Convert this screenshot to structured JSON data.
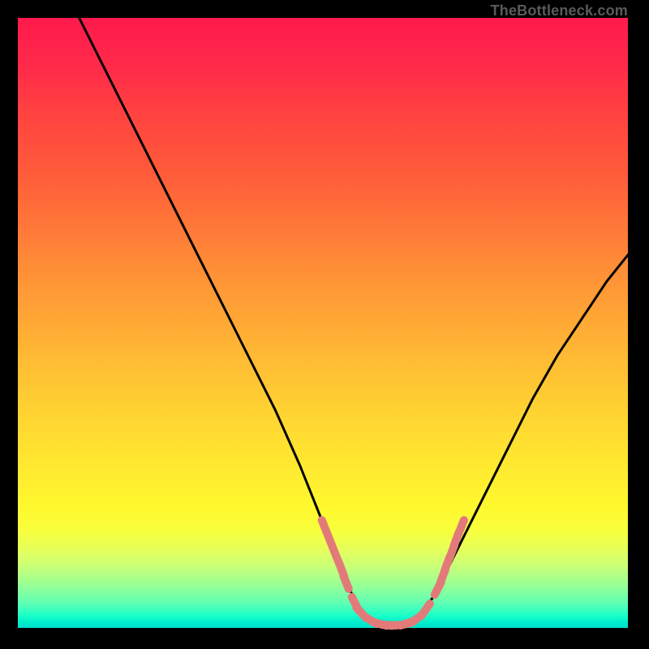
{
  "watermark": {
    "text": "TheBottleneck.com"
  },
  "colors": {
    "curve_stroke": "#000000",
    "marker_fill": "#e37a7a",
    "marker_stroke": "#e37a7a",
    "frame": "#000000"
  },
  "chart_data": {
    "type": "line",
    "title": "",
    "xlabel": "",
    "ylabel": "",
    "xlim": [
      0,
      100
    ],
    "ylim": [
      0,
      100
    ],
    "grid": false,
    "series": [
      {
        "name": "bottleneck-curve",
        "x": [
          10,
          14,
          18,
          22,
          26,
          30,
          34,
          38,
          42,
          46,
          48,
          50,
          52,
          54,
          55,
          56,
          58,
          60,
          62,
          64,
          66,
          68,
          70,
          72,
          76,
          80,
          84,
          88,
          92,
          96,
          100
        ],
        "y": [
          100,
          92,
          84,
          76,
          68,
          60,
          52,
          44,
          36,
          27,
          22,
          17,
          12,
          7,
          5,
          3,
          1.5,
          1,
          1,
          1.5,
          3,
          6,
          10,
          14,
          22,
          30,
          38,
          45,
          51,
          57,
          62
        ]
      }
    ],
    "markers": {
      "name": "highlighted-region",
      "points": [
        {
          "x": 50,
          "y": 17
        },
        {
          "x": 51,
          "y": 14.5
        },
        {
          "x": 52,
          "y": 12
        },
        {
          "x": 52.8,
          "y": 10
        },
        {
          "x": 53.5,
          "y": 8
        },
        {
          "x": 55,
          "y": 4.5
        },
        {
          "x": 56,
          "y": 3
        },
        {
          "x": 57.5,
          "y": 1.8
        },
        {
          "x": 59,
          "y": 1.2
        },
        {
          "x": 60.5,
          "y": 1
        },
        {
          "x": 62,
          "y": 1
        },
        {
          "x": 63.5,
          "y": 1.3
        },
        {
          "x": 65,
          "y": 2
        },
        {
          "x": 66.5,
          "y": 3.5
        },
        {
          "x": 68.5,
          "y": 7
        },
        {
          "x": 69.3,
          "y": 9
        },
        {
          "x": 70,
          "y": 11
        },
        {
          "x": 70.8,
          "y": 13
        },
        {
          "x": 71.5,
          "y": 15
        },
        {
          "x": 72.3,
          "y": 17
        }
      ]
    }
  }
}
